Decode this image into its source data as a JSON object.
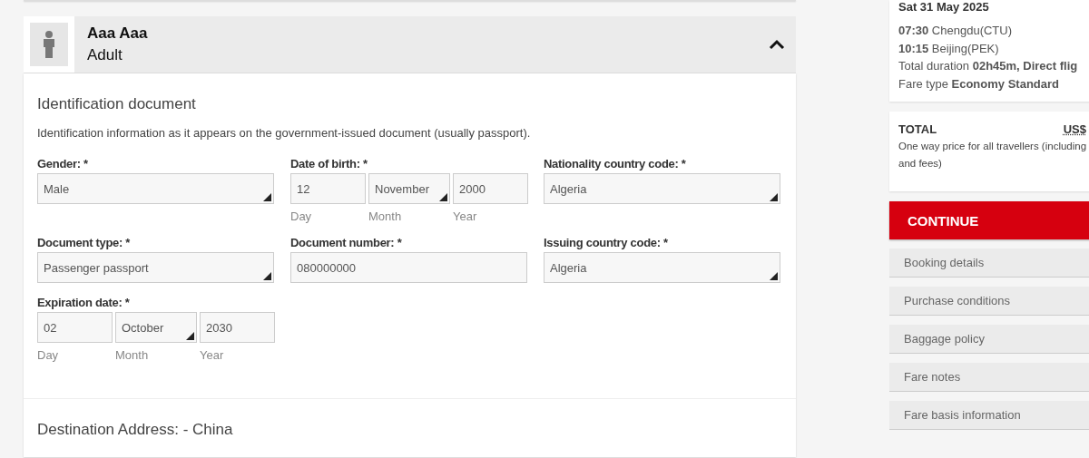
{
  "passenger": {
    "name": "Aaa Aaa",
    "type": "Adult",
    "expanded": true
  },
  "document": {
    "title": "Identification document",
    "description": "Identification information as it appears on the government-issued document (usually passport).",
    "fields": [
      {
        "kind": "select",
        "label": "Gender: *",
        "value": "Male"
      },
      {
        "kind": "date",
        "label": "Date of birth: *",
        "day": "12",
        "month": "November",
        "year": "2000",
        "day_label": "Day",
        "month_label": "Month",
        "year_label": "Year"
      },
      {
        "kind": "select",
        "label": "Nationality country code: *",
        "value": "Algeria"
      },
      {
        "kind": "select",
        "label": "Document type: *",
        "value": "Passenger passport"
      },
      {
        "kind": "text",
        "label": "Document number: *",
        "value": "080000000"
      },
      {
        "kind": "select",
        "label": "Issuing country code: *",
        "value": "Algeria"
      },
      {
        "kind": "date",
        "label": "Expiration date: *",
        "day": "02",
        "month": "October",
        "year": "2030",
        "day_label": "Day",
        "month_label": "Month",
        "year_label": "Year"
      }
    ]
  },
  "next_section": {
    "title": "Destination Address: - China"
  },
  "summary": {
    "date": "Sat 31 May 2025",
    "lines": [
      "**07:30** Chengdu(CTU)",
      "**10:15** Beijing(PEK)",
      "Total duration **02h45m, Direct flig**",
      "Fare type **Economy Standard**"
    ],
    "total_label": "TOTAL",
    "currency": "US$",
    "total_note": "One way price for all travellers (including and fees)"
  },
  "continue_button": "CONTINUE",
  "links": [
    "Booking details",
    "Purchase conditions",
    "Baggage policy",
    "Fare notes",
    "Fare basis information"
  ]
}
